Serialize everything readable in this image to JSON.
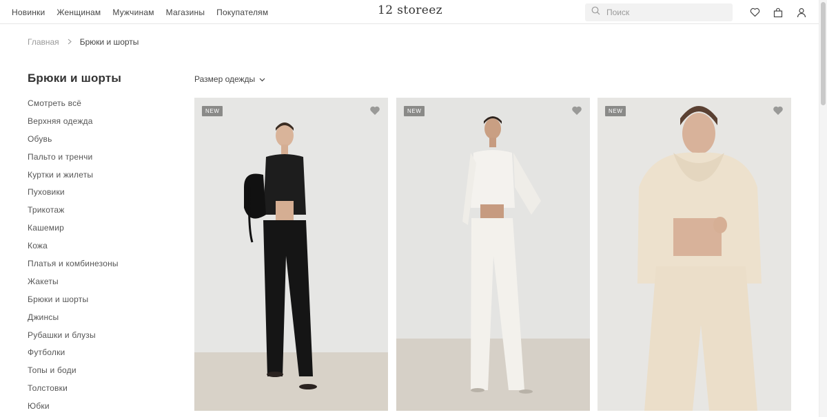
{
  "header": {
    "nav": [
      "Новинки",
      "Женщинам",
      "Мужчинам",
      "Магазины",
      "Покупателям"
    ],
    "logo": "12 storeez",
    "search_placeholder": "Поиск",
    "icons": [
      "heart-icon",
      "bag-icon",
      "user-icon"
    ]
  },
  "breadcrumb": {
    "home": "Главная",
    "separator": ">",
    "current": "Брюки и шорты"
  },
  "category": {
    "title": "Брюки и шорты",
    "items": [
      "Смотреть всё",
      "Верхняя одежда",
      "Обувь",
      "Пальто и тренчи",
      "Куртки и жилеты",
      "Пуховики",
      "Трикотаж",
      "Кашемир",
      "Кожа",
      "Платья и комбинезоны",
      "Жакеты",
      "Брюки и шорты",
      "Джинсы",
      "Рубашки и блузы",
      "Футболки",
      "Топы и боди",
      "Толстовки",
      "Юбки"
    ]
  },
  "filter": {
    "label": "Размер одежды"
  },
  "products": [
    {
      "badge": "NEW",
      "outfit": "black knit cardigan and wide trousers",
      "color": "#1e1e1e"
    },
    {
      "badge": "NEW",
      "outfit": "white knit cardigan and wide trousers",
      "color": "#f1efea"
    },
    {
      "badge": "NEW",
      "outfit": "beige hoodie and sweat shorts",
      "color": "#ece0cc"
    }
  ],
  "colors": {
    "text": "#2b2b2b",
    "muted": "#9a9a9a",
    "badge_bg": "#8a8a88",
    "search_bg": "#f2f2f2"
  }
}
